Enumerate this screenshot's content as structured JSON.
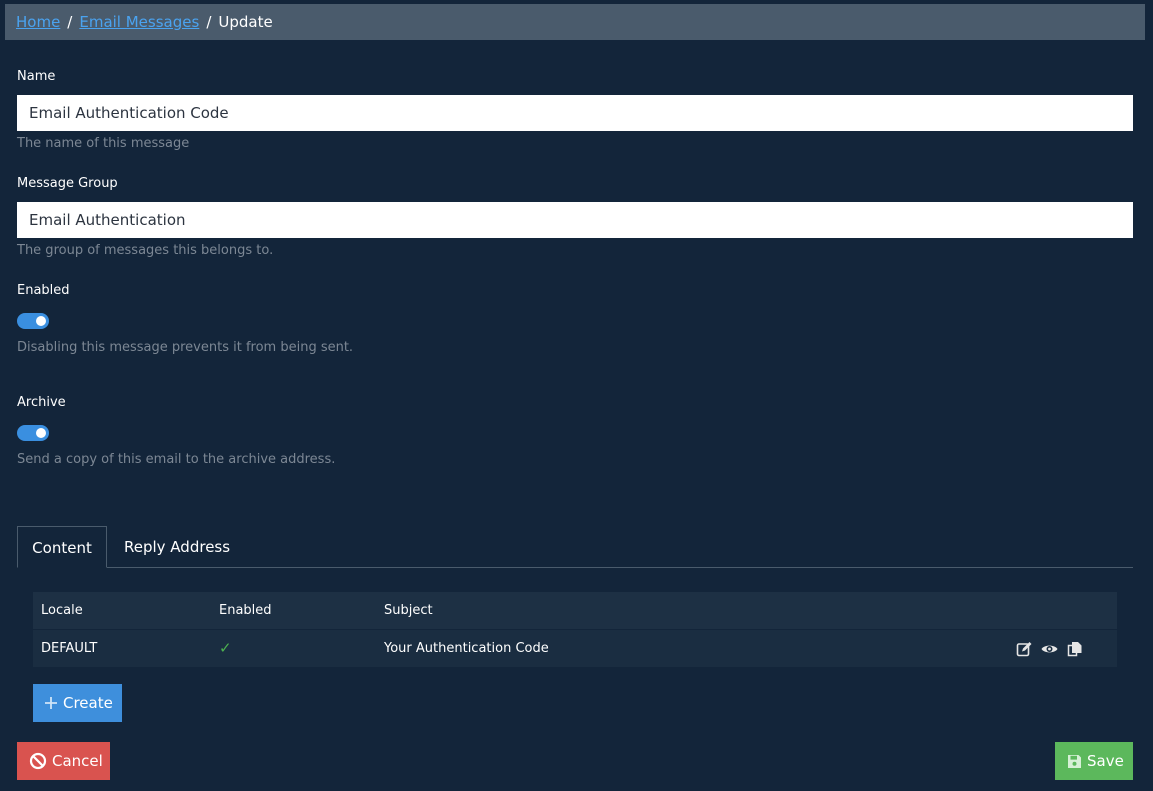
{
  "breadcrumb": {
    "home": "Home",
    "email_messages": "Email Messages",
    "current": "Update",
    "separator": "/"
  },
  "form": {
    "name": {
      "label": "Name",
      "value": "Email Authentication Code",
      "help": "The name of this message"
    },
    "message_group": {
      "label": "Message Group",
      "value": "Email Authentication",
      "help": "The group of messages this belongs to."
    },
    "enabled": {
      "label": "Enabled",
      "checked": true,
      "help": "Disabling this message prevents it from being sent."
    },
    "archive": {
      "label": "Archive",
      "checked": true,
      "help": "Send a copy of this email to the archive address."
    }
  },
  "tabs": [
    {
      "label": "Content",
      "active": true
    },
    {
      "label": "Reply Address",
      "active": false
    }
  ],
  "table": {
    "headers": [
      "Locale",
      "Enabled",
      "Subject"
    ],
    "rows": [
      {
        "locale": "DEFAULT",
        "enabled": "✓",
        "subject": "Your Authentication Code",
        "actions": [
          "edit-icon",
          "view-icon",
          "copy-icon"
        ]
      }
    ]
  },
  "buttons": {
    "create": "Create",
    "cancel": "Cancel",
    "save": "Save"
  },
  "colors": {
    "background": "#13253a",
    "accent": "#3e8fdc",
    "danger": "#d9534f",
    "success": "#5cb85c"
  }
}
